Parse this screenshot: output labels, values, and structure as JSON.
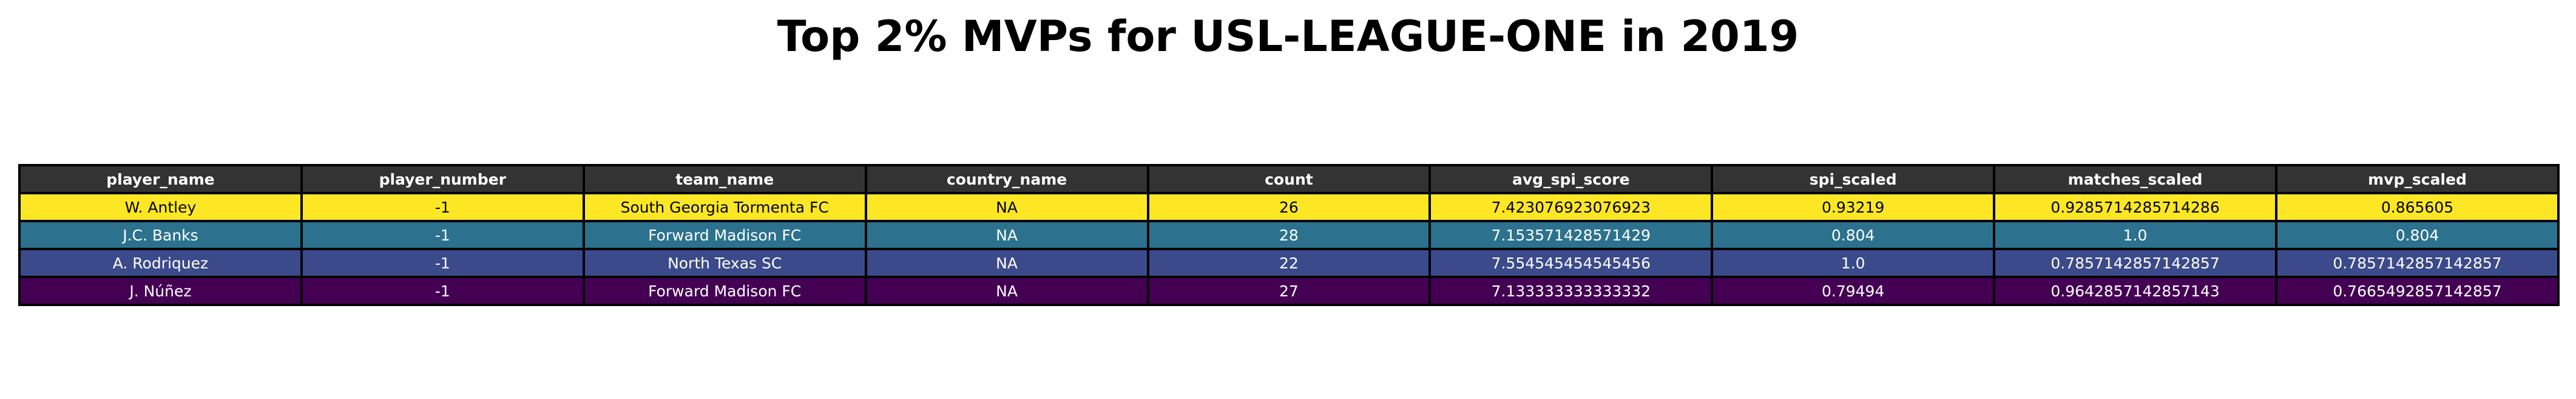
{
  "chart_data": {
    "type": "table",
    "title": "Top 2% MVPs for USL-LEAGUE-ONE in 2019",
    "header_color": "#333333",
    "columns": [
      "player_name",
      "player_number",
      "team_name",
      "country_name",
      "count",
      "avg_spi_score",
      "spi_scaled",
      "matches_scaled",
      "mvp_scaled"
    ],
    "rows": [
      {
        "color": "#fde725",
        "text_color": "#000000",
        "cells": [
          "W. Antley",
          "-1",
          "South Georgia Tormenta FC",
          "NA",
          "26",
          "7.423076923076923",
          "0.93219",
          "0.9285714285714286",
          "0.865605"
        ]
      },
      {
        "color": "#2c728e",
        "text_color": "#ffffff",
        "cells": [
          "J.C. Banks",
          "-1",
          "Forward Madison FC",
          "NA",
          "28",
          "7.153571428571429",
          "0.804",
          "1.0",
          "0.804"
        ]
      },
      {
        "color": "#3b4a8a",
        "text_color": "#ffffff",
        "cells": [
          "A. Rodriquez",
          "-1",
          "North Texas SC",
          "NA",
          "22",
          "7.554545454545456",
          "1.0",
          "0.7857142857142857",
          "0.7857142857142857"
        ]
      },
      {
        "color": "#440154",
        "text_color": "#ffffff",
        "cells": [
          "J. Núñez",
          "-1",
          "Forward Madison FC",
          "NA",
          "27",
          "7.133333333333332",
          "0.79494",
          "0.9642857142857143",
          "0.7665492857142857"
        ]
      }
    ]
  }
}
